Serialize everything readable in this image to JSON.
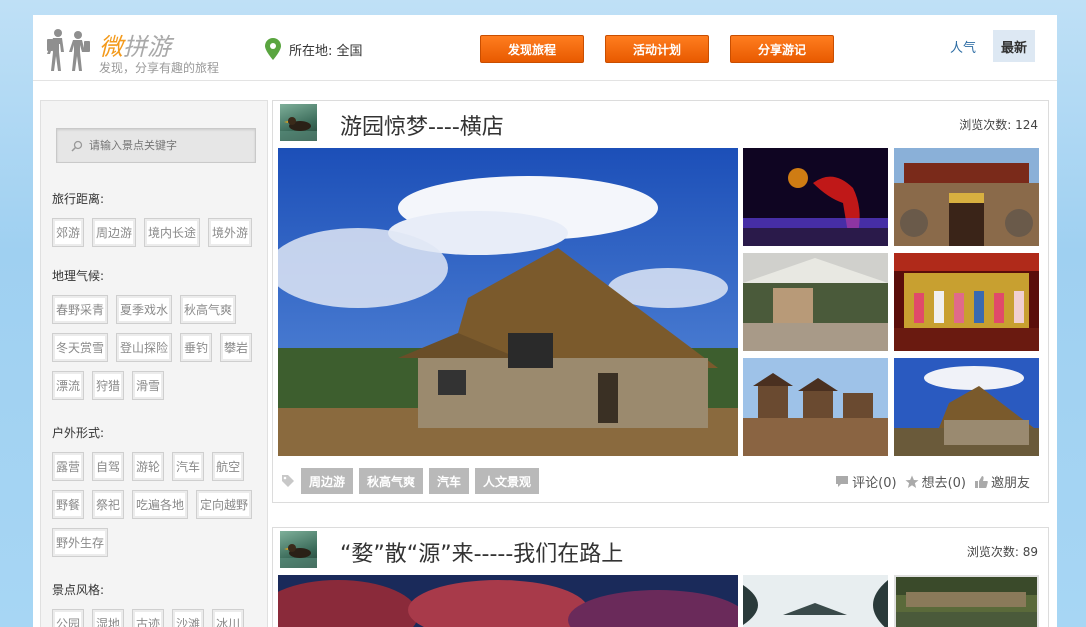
{
  "header": {
    "logo_accent": "微",
    "logo_rest": "拼游",
    "logo_subtitle": "发现，分享有趣的旅程",
    "location_label": "所在地: 全国",
    "nav": [
      "发现旅程",
      "活动计划",
      "分享游记"
    ],
    "sort_popular": "人气",
    "sort_latest": "最新"
  },
  "sidebar": {
    "search_placeholder": "请输入景点关键字",
    "groups": [
      {
        "title": "旅行距离:",
        "tags": [
          "郊游",
          "周边游",
          "境内长途",
          "境外游"
        ]
      },
      {
        "title": "地理气候:",
        "tags": [
          "春野采青",
          "夏季戏水",
          "秋高气爽",
          "冬天赏雪",
          "登山探险",
          "垂钓",
          "攀岩",
          "漂流",
          "狩猎",
          "滑雪"
        ]
      },
      {
        "title": "户外形式:",
        "tags": [
          "露营",
          "自驾",
          "游轮",
          "汽车",
          "航空",
          "野餐",
          "祭祀",
          "吃遍各地",
          "定向越野",
          "野外生存"
        ]
      },
      {
        "title": "景点风格:",
        "tags": [
          "公园",
          "湿地",
          "古迹",
          "沙滩",
          "冰川"
        ]
      }
    ]
  },
  "posts": [
    {
      "title": "游园惊梦----横店",
      "views": "浏览次数: 124",
      "tags": [
        "周边游",
        "秋高气爽",
        "汽车",
        "人文景观"
      ],
      "comments": "评论(0)",
      "want": "想去(0)",
      "invite": "邀朋友"
    },
    {
      "title": "“婺”散“源”来-----我们在路上",
      "views": "浏览次数: 89"
    }
  ],
  "colors": {
    "accent_orange": "#f07016",
    "logo_orange": "#f39a1c",
    "link_blue": "#2e6da4"
  }
}
